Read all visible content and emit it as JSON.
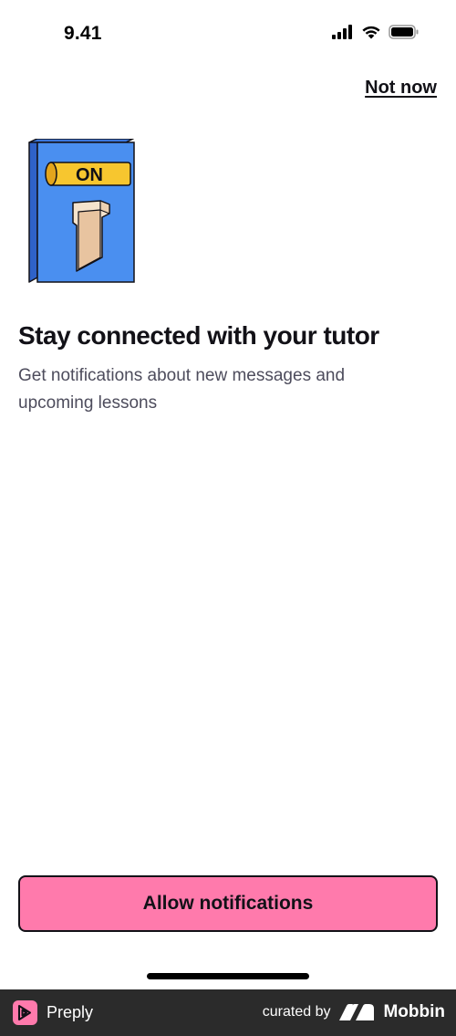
{
  "status_bar": {
    "time": "9.41",
    "icons": [
      "cellular-signal-icon",
      "wifi-icon",
      "battery-icon"
    ]
  },
  "header": {
    "not_now_label": "Not now"
  },
  "illustration": {
    "switch_label": "ON",
    "icon": "on-switch-illustration"
  },
  "content": {
    "title": "Stay connected with your tutor",
    "subtitle": "Get notifications about new messages and upcoming lessons"
  },
  "cta": {
    "label": "Allow notifications"
  },
  "footer": {
    "app_name": "Preply",
    "curated_by": "curated by",
    "curator_name": "Mobbin"
  },
  "colors": {
    "accent": "#ff7aac",
    "text_primary": "#121117",
    "text_secondary": "#4d4c5c",
    "footer_bg": "#2b2b2b",
    "switch_blue": "#4a8ff0",
    "switch_yellow": "#f7c62f"
  }
}
